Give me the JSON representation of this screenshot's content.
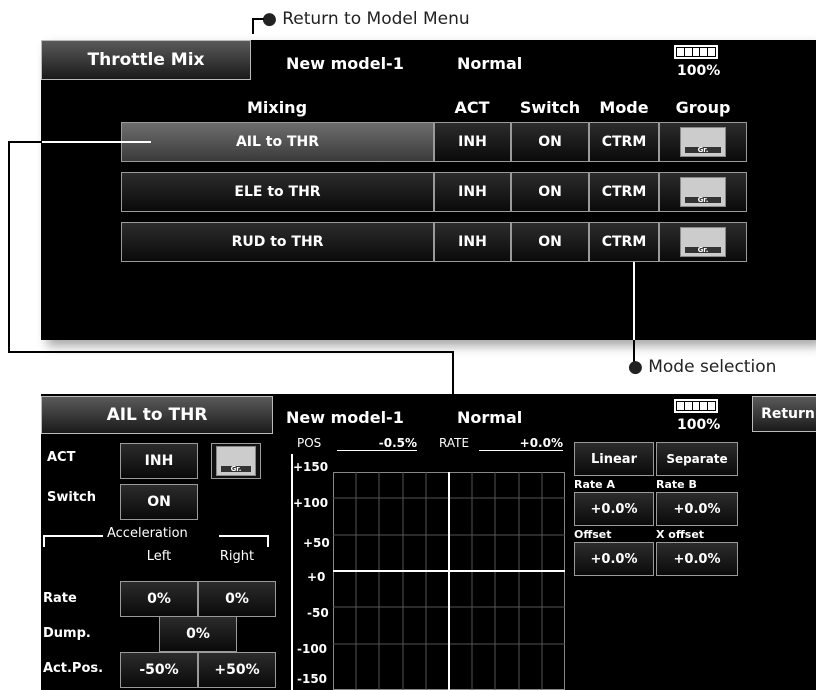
{
  "callouts": {
    "return_to_menu": "● Return to Model Menu",
    "mode_selection": "● Mode selection"
  },
  "top_screen": {
    "title": "Throttle Mix",
    "model": "New model-1",
    "condition": "Normal",
    "battery": "100%",
    "headers": {
      "mixing": "Mixing",
      "act": "ACT",
      "switch": "Switch",
      "mode": "Mode",
      "group": "Group"
    },
    "rows": [
      {
        "name": "AIL to THR",
        "act": "INH",
        "switch": "ON",
        "mode": "CTRM",
        "group": "Gr."
      },
      {
        "name": "ELE to THR",
        "act": "INH",
        "switch": "ON",
        "mode": "CTRM",
        "group": "Gr."
      },
      {
        "name": "RUD to THR",
        "act": "INH",
        "switch": "ON",
        "mode": "CTRM",
        "group": "Gr."
      }
    ]
  },
  "bottom_screen": {
    "title": "AIL to THR",
    "model": "New model-1",
    "condition": "Normal",
    "battery": "100%",
    "return_label": "Return",
    "act_label": "ACT",
    "act_value": "INH",
    "group": "Gr.",
    "switch_label": "Switch",
    "switch_value": "ON",
    "accel_label": "Acceleration",
    "left_label": "Left",
    "right_label": "Right",
    "rate_label": "Rate",
    "rate_left": "0%",
    "rate_right": "0%",
    "dump_label": "Dump.",
    "dump_value": "0%",
    "actpos_label": "Act.Pos.",
    "actpos_left": "-50%",
    "actpos_right": "+50%",
    "pos_label": "POS",
    "pos_value": "-0.5%",
    "rate_hdr": "RATE",
    "rate_value": "+0.0%",
    "y_ticks": [
      "+150",
      "+100",
      "+50",
      "+0",
      "-50",
      "-100",
      "-150"
    ],
    "curve_type": "Linear",
    "separate_label": "Separate",
    "rate_a_label": "Rate A",
    "rate_a": "+0.0%",
    "rate_b_label": "Rate B",
    "rate_b": "+0.0%",
    "offset_label": "Offset",
    "offset": "+0.0%",
    "x_offset_label": "X offset",
    "x_offset": "+0.0%"
  }
}
